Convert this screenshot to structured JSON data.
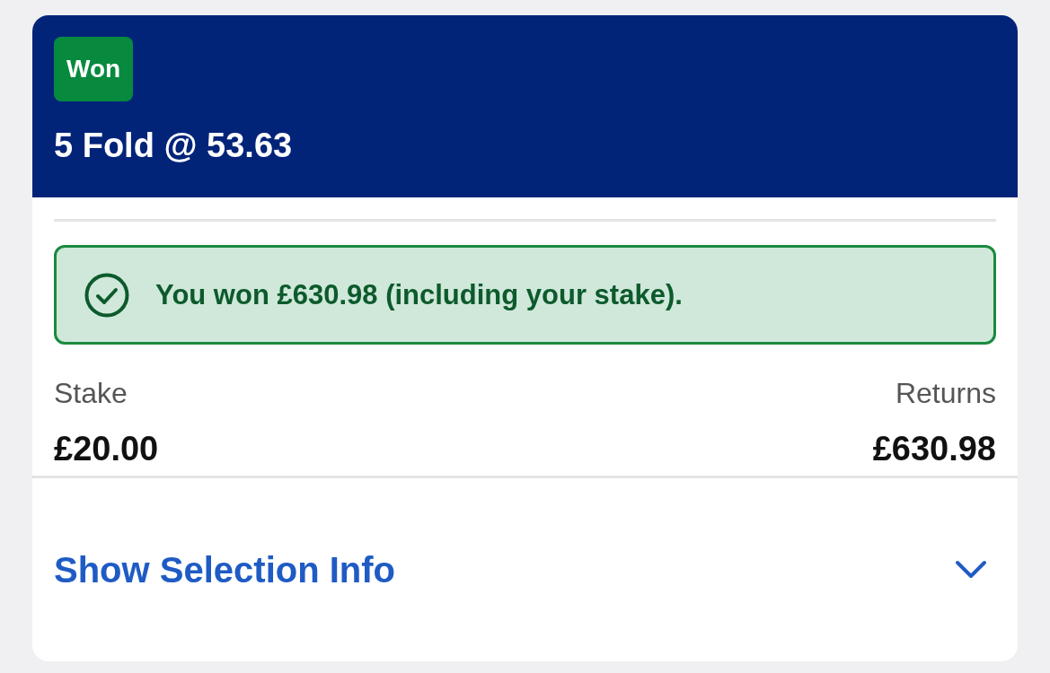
{
  "bet": {
    "status": "Won",
    "title": "5 Fold @ 53.63"
  },
  "result_banner": {
    "message": "You won £630.98 (including your stake)."
  },
  "summary": [
    {
      "label": "Stake",
      "value": "£20.00"
    },
    {
      "label": "Returns",
      "value": "£630.98"
    }
  ],
  "selection_toggle": {
    "label": "Show Selection Info",
    "expanded": false
  }
}
